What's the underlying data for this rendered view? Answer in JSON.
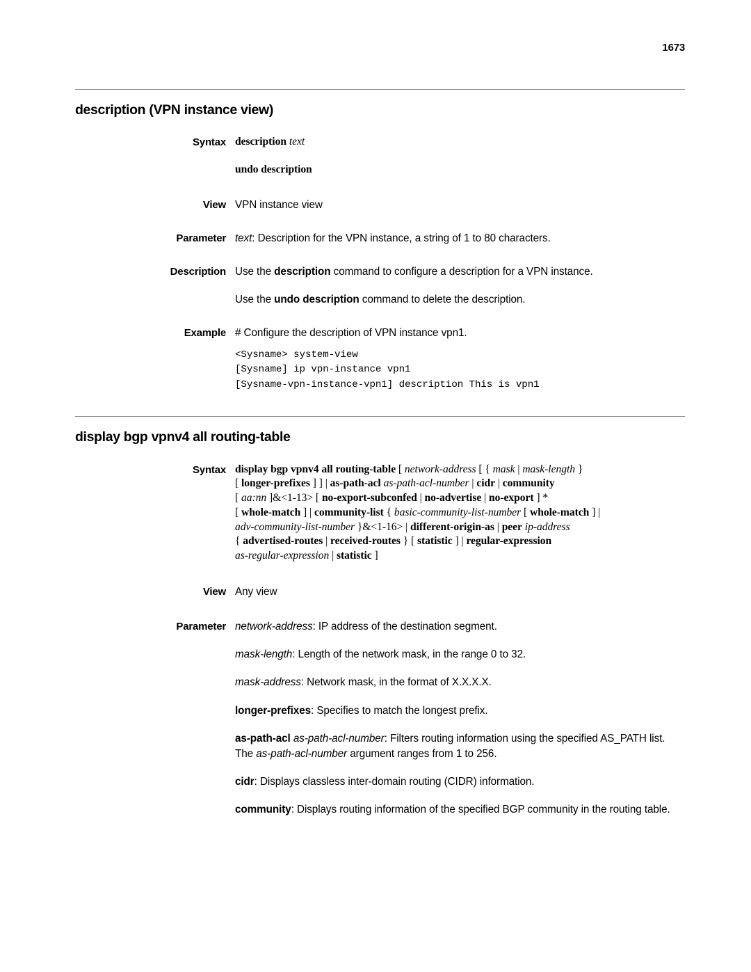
{
  "folio": "1673",
  "sections": [
    {
      "title": "description (VPN instance view)",
      "labels": {
        "syntax": "Syntax",
        "view": "View",
        "parameter": "Parameter",
        "description": "Description",
        "example": "Example"
      },
      "syntax_cmd_bold": "description",
      "syntax_cmd_italic": "text",
      "syntax_undo": "undo description",
      "view_text": "VPN instance view",
      "parameter_italic": "text",
      "parameter_text": ": Description for the VPN instance, a string of 1 to 80 characters.",
      "description_1_pre": "Use the ",
      "description_1_bold": "description",
      "description_1_post": " command to configure a description for a VPN instance.",
      "description_2_pre": "Use the ",
      "description_2_bold": "undo description",
      "description_2_post": " command to delete the description.",
      "example_comment": "# Configure the description of VPN instance vpn1.",
      "example_code": "<Sysname> system-view\n[Sysname] ip vpn-instance vpn1\n[Sysname-vpn-instance-vpn1] description This is vpn1"
    },
    {
      "title": "display bgp vpnv4 all routing-table",
      "labels": {
        "syntax": "Syntax",
        "view": "View",
        "parameter": "Parameter"
      },
      "syntax_lines": [
        [
          {
            "t": "display bgp vpnv4 all routing-table",
            "s": "b"
          },
          {
            "t": " [ ",
            "s": "n"
          },
          {
            "t": "network-address",
            "s": "i"
          },
          {
            "t": " [ { ",
            "s": "n"
          },
          {
            "t": "mask",
            "s": "i"
          },
          {
            "t": " | ",
            "s": "n"
          },
          {
            "t": "mask-length",
            "s": "i"
          },
          {
            "t": " }",
            "s": "n"
          }
        ],
        [
          {
            "t": "[ ",
            "s": "n"
          },
          {
            "t": "longer-prefixes",
            "s": "b"
          },
          {
            "t": " ] ] | ",
            "s": "n"
          },
          {
            "t": "as-path-acl",
            "s": "b"
          },
          {
            "t": " ",
            "s": "n"
          },
          {
            "t": "as-path-acl-number",
            "s": "i"
          },
          {
            "t": " | ",
            "s": "n"
          },
          {
            "t": "cidr",
            "s": "b"
          },
          {
            "t": " | ",
            "s": "n"
          },
          {
            "t": "community",
            "s": "b"
          }
        ],
        [
          {
            "t": "[ ",
            "s": "n"
          },
          {
            "t": "aa:nn",
            "s": "i"
          },
          {
            "t": " ]&<1-13> [ ",
            "s": "n"
          },
          {
            "t": "no-export-subconfed",
            "s": "b"
          },
          {
            "t": " | ",
            "s": "n"
          },
          {
            "t": "no-advertise",
            "s": "b"
          },
          {
            "t": " | ",
            "s": "n"
          },
          {
            "t": "no-export",
            "s": "b"
          },
          {
            "t": " ] *",
            "s": "n"
          }
        ],
        [
          {
            "t": "[ ",
            "s": "n"
          },
          {
            "t": "whole-match",
            "s": "b"
          },
          {
            "t": " ] | ",
            "s": "n"
          },
          {
            "t": "community-list",
            "s": "b"
          },
          {
            "t": " { ",
            "s": "n"
          },
          {
            "t": "basic-community-list-number",
            "s": "i"
          },
          {
            "t": " [ ",
            "s": "n"
          },
          {
            "t": "whole-match",
            "s": "b"
          },
          {
            "t": " ] |",
            "s": "n"
          }
        ],
        [
          {
            "t": "adv-community-list-number",
            "s": "i"
          },
          {
            "t": " }&<1-16> | ",
            "s": "n"
          },
          {
            "t": "different-origin-as",
            "s": "b"
          },
          {
            "t": " | ",
            "s": "n"
          },
          {
            "t": "peer",
            "s": "b"
          },
          {
            "t": " ",
            "s": "n"
          },
          {
            "t": "ip-address",
            "s": "i"
          }
        ],
        [
          {
            "t": "{ ",
            "s": "n"
          },
          {
            "t": "advertised-routes",
            "s": "b"
          },
          {
            "t": " | ",
            "s": "n"
          },
          {
            "t": "received-routes",
            "s": "b"
          },
          {
            "t": " } [ ",
            "s": "n"
          },
          {
            "t": "statistic",
            "s": "b"
          },
          {
            "t": " ] | ",
            "s": "n"
          },
          {
            "t": "regular-expression",
            "s": "b"
          }
        ],
        [
          {
            "t": "as-regular-expression",
            "s": "i"
          },
          {
            "t": " | ",
            "s": "n"
          },
          {
            "t": "statistic",
            "s": "b"
          },
          {
            "t": " ]",
            "s": "n"
          }
        ]
      ],
      "view_text": "Any view",
      "parameters": [
        [
          {
            "t": "network-address",
            "s": "i"
          },
          {
            "t": ": IP address of the destination segment.",
            "s": "n"
          }
        ],
        [
          {
            "t": "mask-length",
            "s": "i"
          },
          {
            "t": ": Length of the network mask, in the range 0 to 32.",
            "s": "n"
          }
        ],
        [
          {
            "t": "mask-address",
            "s": "i"
          },
          {
            "t": ": Network mask, in the format of X.X.X.X.",
            "s": "n"
          }
        ],
        [
          {
            "t": "longer-prefixes",
            "s": "b"
          },
          {
            "t": ": Specifies to match the longest prefix.",
            "s": "n"
          }
        ],
        [
          {
            "t": "as-path-acl",
            "s": "b"
          },
          {
            "t": " ",
            "s": "n"
          },
          {
            "t": "as-path-acl-number",
            "s": "i"
          },
          {
            "t": ": Filters routing information using the specified AS_PATH list. The ",
            "s": "n"
          },
          {
            "t": "as-path-acl-number",
            "s": "i"
          },
          {
            "t": " argument ranges from 1 to 256.",
            "s": "n"
          }
        ],
        [
          {
            "t": "cidr",
            "s": "b"
          },
          {
            "t": ": Displays classless inter-domain routing (CIDR) information.",
            "s": "n"
          }
        ],
        [
          {
            "t": "community",
            "s": "b"
          },
          {
            "t": ": Displays routing information of the specified BGP community in the routing table.",
            "s": "n"
          }
        ]
      ]
    }
  ]
}
